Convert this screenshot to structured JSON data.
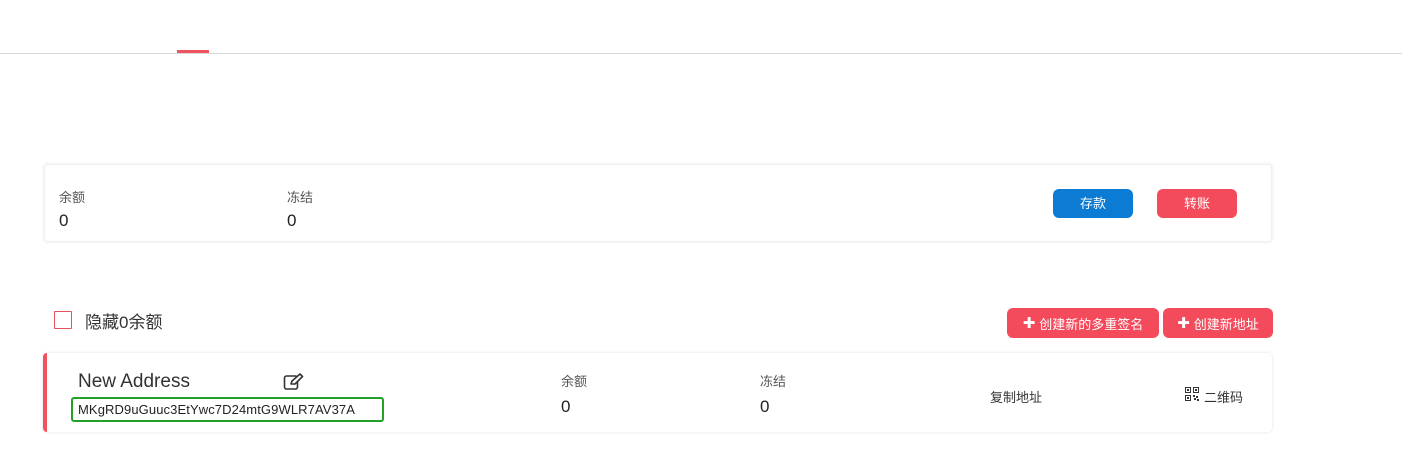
{
  "summary": {
    "balance_label": "余额",
    "balance_value": "0",
    "frozen_label": "冻结",
    "frozen_value": "0",
    "deposit_button": "存款",
    "transfer_button": "转账"
  },
  "controls": {
    "hide_zero_label": "隐藏0余额",
    "hide_zero_checked": false,
    "create_multisig_button": "创建新的多重签名",
    "create_address_button": "创建新地址"
  },
  "address": {
    "name": "New Address",
    "value": "MKgRD9uGuuc3EtYwc7D24mtG9WLR7AV37A",
    "balance_label": "余额",
    "balance_value": "0",
    "frozen_label": "冻结",
    "frozen_value": "0",
    "copy_label": "复制地址",
    "qr_label": "二维码"
  },
  "colors": {
    "accent_red": "#f44b5c",
    "primary_blue": "#0b7bd4",
    "highlight_green": "#22a02a"
  }
}
